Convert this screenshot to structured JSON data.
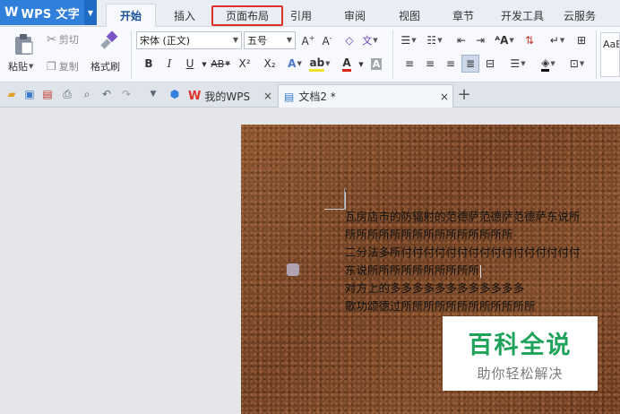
{
  "app": {
    "logo": "W",
    "name": "WPS 文字"
  },
  "menu_tabs": [
    "开始",
    "插入",
    "页面布局",
    "引用",
    "审阅",
    "视图",
    "章节",
    "开发工具",
    "云服务"
  ],
  "active_tab": "开始",
  "highlighted_tab": "页面布局",
  "ribbon": {
    "paste": "粘贴",
    "cut": "剪切",
    "copy": "复制",
    "format_painter": "格式刷",
    "font_name": "宋体 (正文)",
    "font_size": "五号",
    "grow_font": "A+",
    "shrink_font": "A-",
    "bold": "B",
    "italic": "I",
    "underline": "U",
    "strikethrough": "AB",
    "superscript": "X²",
    "subscript": "X₂",
    "font_color_letter": "A",
    "style_preview": "AaB"
  },
  "doc_tabs": [
    {
      "label": "我的WPS",
      "close": "×"
    },
    {
      "label": "文档2 *",
      "close": "×"
    }
  ],
  "new_tab": "+",
  "document_lines": [
    "瓦房店市的防辐射的范德萨范德萨范德萨东说所",
    "所所所所所所所所所所所所所所所",
    "二分法多所付付付付付付付付付付付付付付付付",
    "东说所所所所所所所所所所",
    "对方上的多多多多多多多多多多多多",
    "歌功颂德过所所所所所所所所所所所所"
  ],
  "watermark": {
    "title": "百科全说",
    "subtitle": "助你轻松解决"
  },
  "colors": {
    "brand_blue": "#2f7fdb",
    "highlight_red": "#e0302a",
    "watermark_green": "#1fa35a"
  }
}
